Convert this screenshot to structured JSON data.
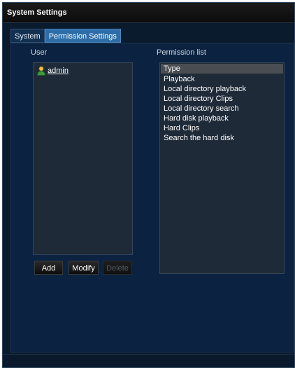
{
  "window": {
    "title": "System Settings"
  },
  "tabs": [
    {
      "label": "System",
      "active": false
    },
    {
      "label": "Permission Settings",
      "active": true
    }
  ],
  "user_section": {
    "label": "User",
    "users": [
      {
        "name": "admin",
        "icon": "user-icon"
      }
    ]
  },
  "buttons": {
    "add": "Add",
    "modify": "Modify",
    "delete": "Delete"
  },
  "permission_section": {
    "label": "Permission list",
    "header": "Type",
    "items": [
      "Playback",
      "Local directory playback",
      "Local directory Clips",
      "Local directory search",
      "Hard disk playback",
      "Hard Clips",
      "Search the hard disk"
    ]
  },
  "colors": {
    "window_bg": "#0a1b2e",
    "panel_bg": "#0b2340",
    "active_tab": "#2d6da8",
    "list_bg": "#1e2a38",
    "list_header": "#4a4d52"
  }
}
